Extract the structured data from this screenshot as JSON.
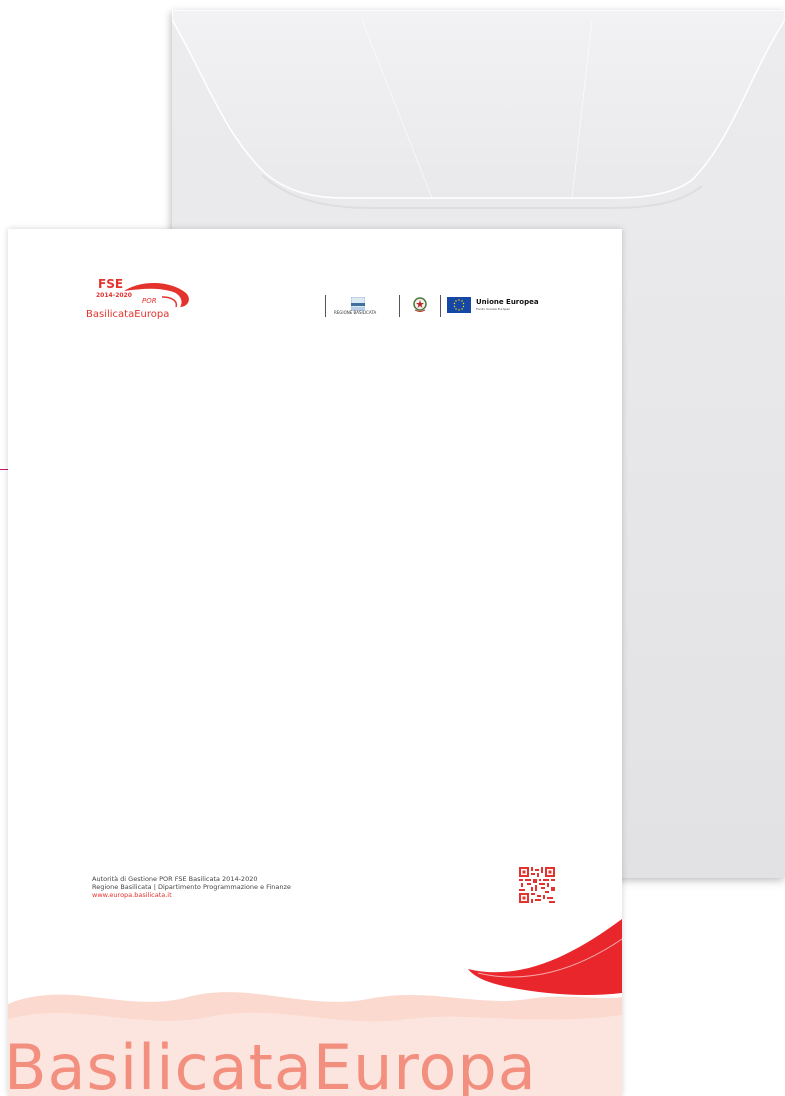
{
  "logo": {
    "fse": "FSE",
    "years": "2014-2020",
    "por": "POR",
    "name": "BasilicataEuropa"
  },
  "partners": {
    "regione": "REGIONE BASILICATA",
    "eu_title": "Unione Europea",
    "eu_subtitle": "Fondo Sociale Europeo"
  },
  "footer": {
    "line1": "Autorità di Gestione POR FSE Basilicata 2014-2020",
    "line2": "Regione Basilicata | Dipartimento Programmazione e Finanze",
    "website": "www.europa.basilicata.it"
  },
  "watermark": "BasilicataEuropa",
  "colors": {
    "brand_red": "#e4322d",
    "accent_magenta": "#d41a7a",
    "eu_blue": "#1447a6"
  },
  "icons": [
    "qr-code-icon",
    "regione-basilicata-icon",
    "italian-emblem-icon",
    "eu-flag-icon"
  ]
}
